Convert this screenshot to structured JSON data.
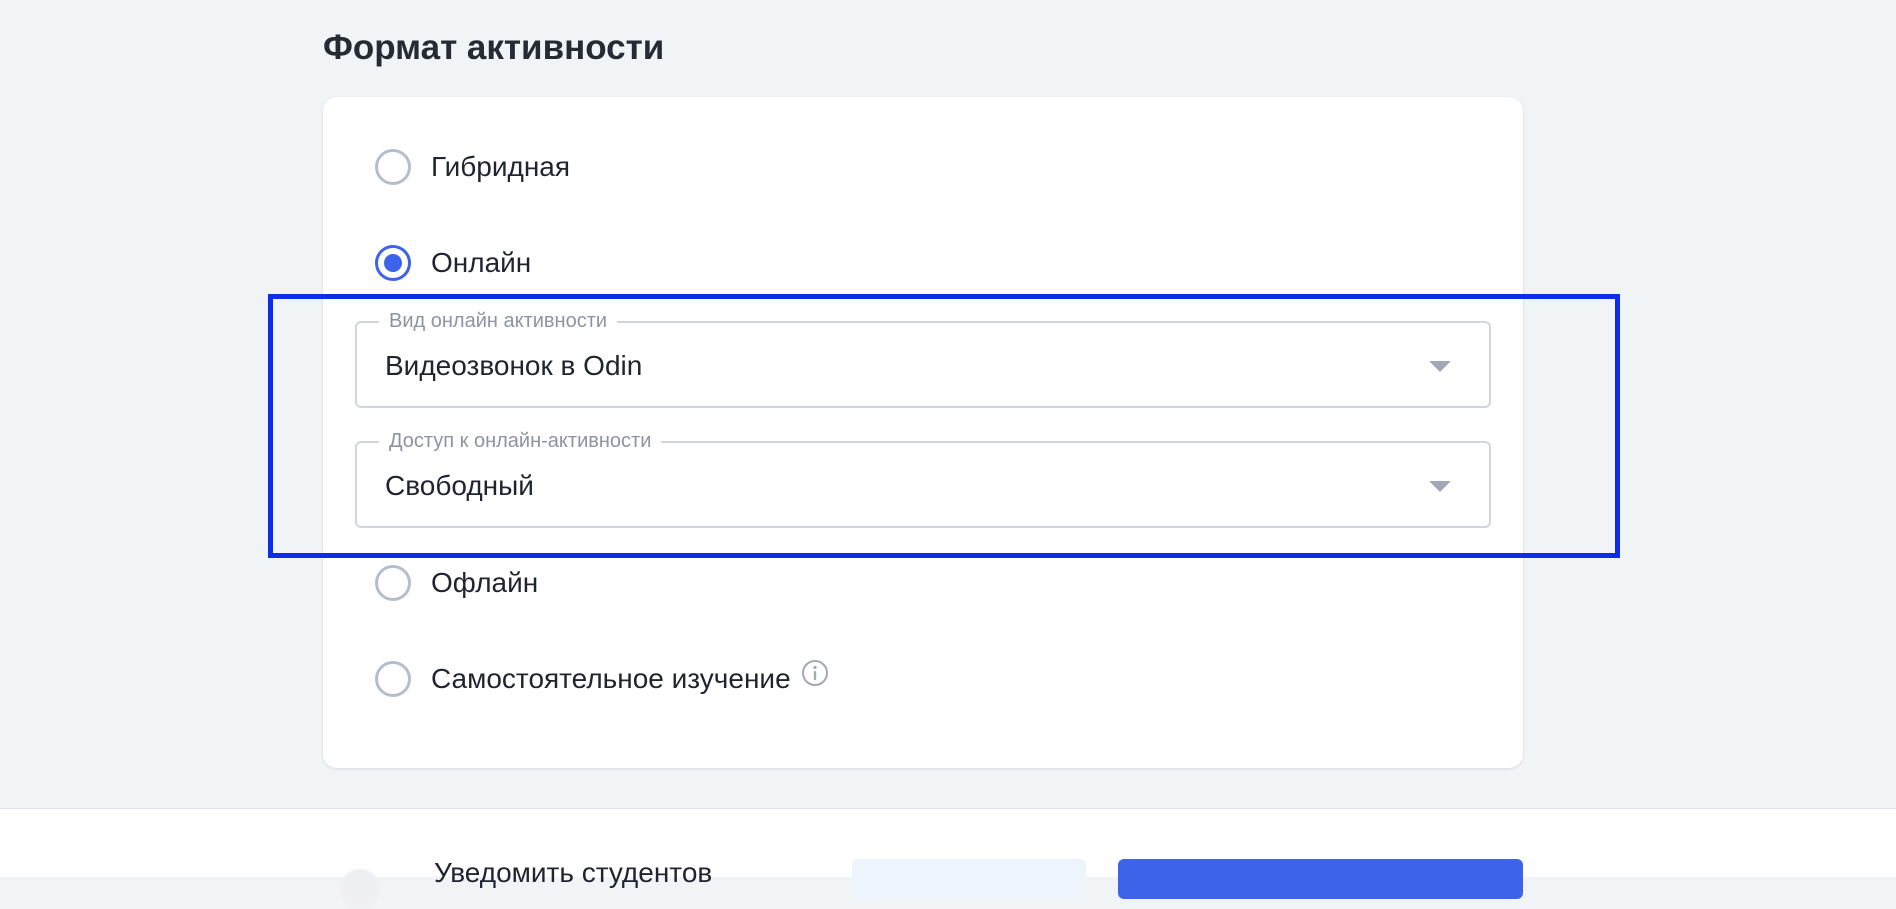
{
  "section": {
    "title": "Формат активности"
  },
  "options": [
    {
      "label": "Гибридная",
      "checked": false
    },
    {
      "label": "Онлайн",
      "checked": true
    },
    {
      "label": "Офлайн",
      "checked": false
    },
    {
      "label": "Самостоятельное изучение",
      "checked": false,
      "icon": "info-icon"
    }
  ],
  "online_fields": {
    "type": {
      "legend": "Вид онлайн активности",
      "value": "Видеозвонок в Odin"
    },
    "access": {
      "legend": "Доступ к онлайн-активности",
      "value": "Свободный"
    }
  },
  "footer": {
    "notify_label": "Уведомить студентов"
  },
  "colors": {
    "accent": "#3d63ea",
    "highlight": "#0b2ee8",
    "background": "#f1f4f7"
  }
}
